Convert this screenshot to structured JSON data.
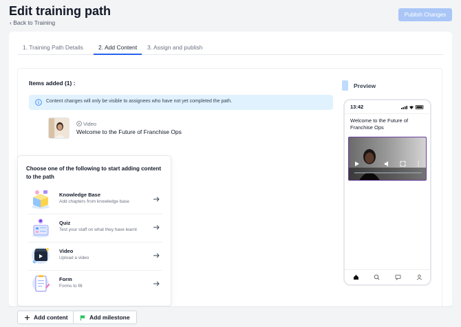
{
  "header": {
    "title": "Edit training path",
    "back_link": "‹ Back to Training",
    "publish_button": "Publish Changes"
  },
  "tabs": [
    {
      "label": "1. Training Path Details",
      "active": false
    },
    {
      "label": "2. Add Content",
      "active": true
    },
    {
      "label": "3. Assign and publish",
      "active": false
    }
  ],
  "content": {
    "items_added_label": "Items added (1) :",
    "info_banner": "Content changes will only be visible to assignees who have not yet completed the path.",
    "items": [
      {
        "type": "Video",
        "title": "Welcome to the Future of Franchise Ops",
        "icon": "play-circle-icon"
      }
    ]
  },
  "chooser": {
    "title": "Choose one of the following to start adding content to the path",
    "options": [
      {
        "label": "Knowledge Base",
        "subtitle": "Add chapters from knowledge base",
        "icon": "knowledge-base-illustration"
      },
      {
        "label": "Quiz",
        "subtitle": "Test your staff on what they have learnt",
        "icon": "quiz-illustration"
      },
      {
        "label": "Video",
        "subtitle": "Upload a video",
        "icon": "video-illustration"
      },
      {
        "label": "Form",
        "subtitle": "Forms to fill",
        "icon": "form-illustration"
      }
    ]
  },
  "preview": {
    "label": "Preview",
    "phone_time": "13:42",
    "phone_title": "Welcome to the Future of Franchise Ops",
    "nav_icons": [
      "home-icon",
      "search-icon",
      "chat-icon",
      "profile-icon"
    ]
  },
  "footer": {
    "add_content": "Add content",
    "add_milestone": "Add milestone"
  },
  "colors": {
    "accent": "#2563eb",
    "publish_disabled": "#a9c6f7",
    "info_bg": "#e0f2fe",
    "milestone_flag": "#22c55e"
  }
}
